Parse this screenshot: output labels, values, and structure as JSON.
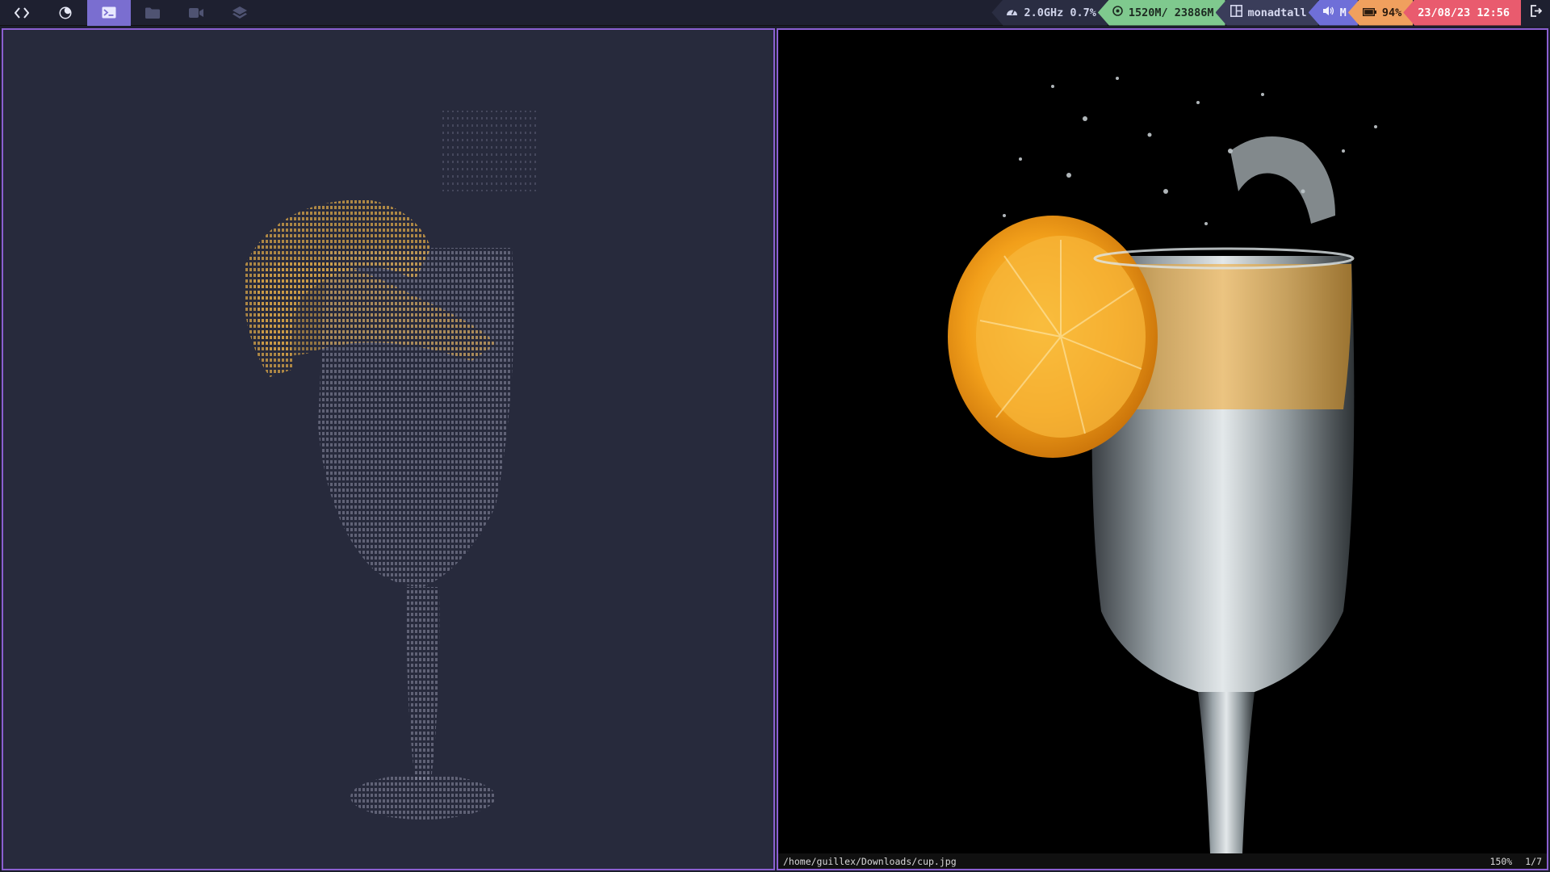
{
  "workspaces": [
    {
      "icon": "code-brackets-icon",
      "active": false
    },
    {
      "icon": "browser-icon",
      "active": false
    },
    {
      "icon": "terminal-icon",
      "active": true
    },
    {
      "icon": "folder-icon",
      "active": false
    },
    {
      "icon": "video-icon",
      "active": false
    },
    {
      "icon": "layers-icon",
      "active": false
    }
  ],
  "status": {
    "cpu": "2.0GHz 0.7%",
    "memory": "1520M/ 23886M",
    "host": "monadtall",
    "volume": "M",
    "battery": "94%",
    "datetime": "23/08/23 12:56"
  },
  "viewer": {
    "path": "/home/guillex/Downloads/cup.jpg",
    "zoom": "150%",
    "index": "1/7"
  },
  "colors": {
    "accent": "#7a6ed0",
    "border": "#8a5fd0",
    "memory": "#7fc98e",
    "volume": "#6f6fd8",
    "battery": "#f0a05e",
    "date": "#e95b6e",
    "ascii_glow": "#d9a548",
    "ascii_dim": "#6e7088"
  }
}
